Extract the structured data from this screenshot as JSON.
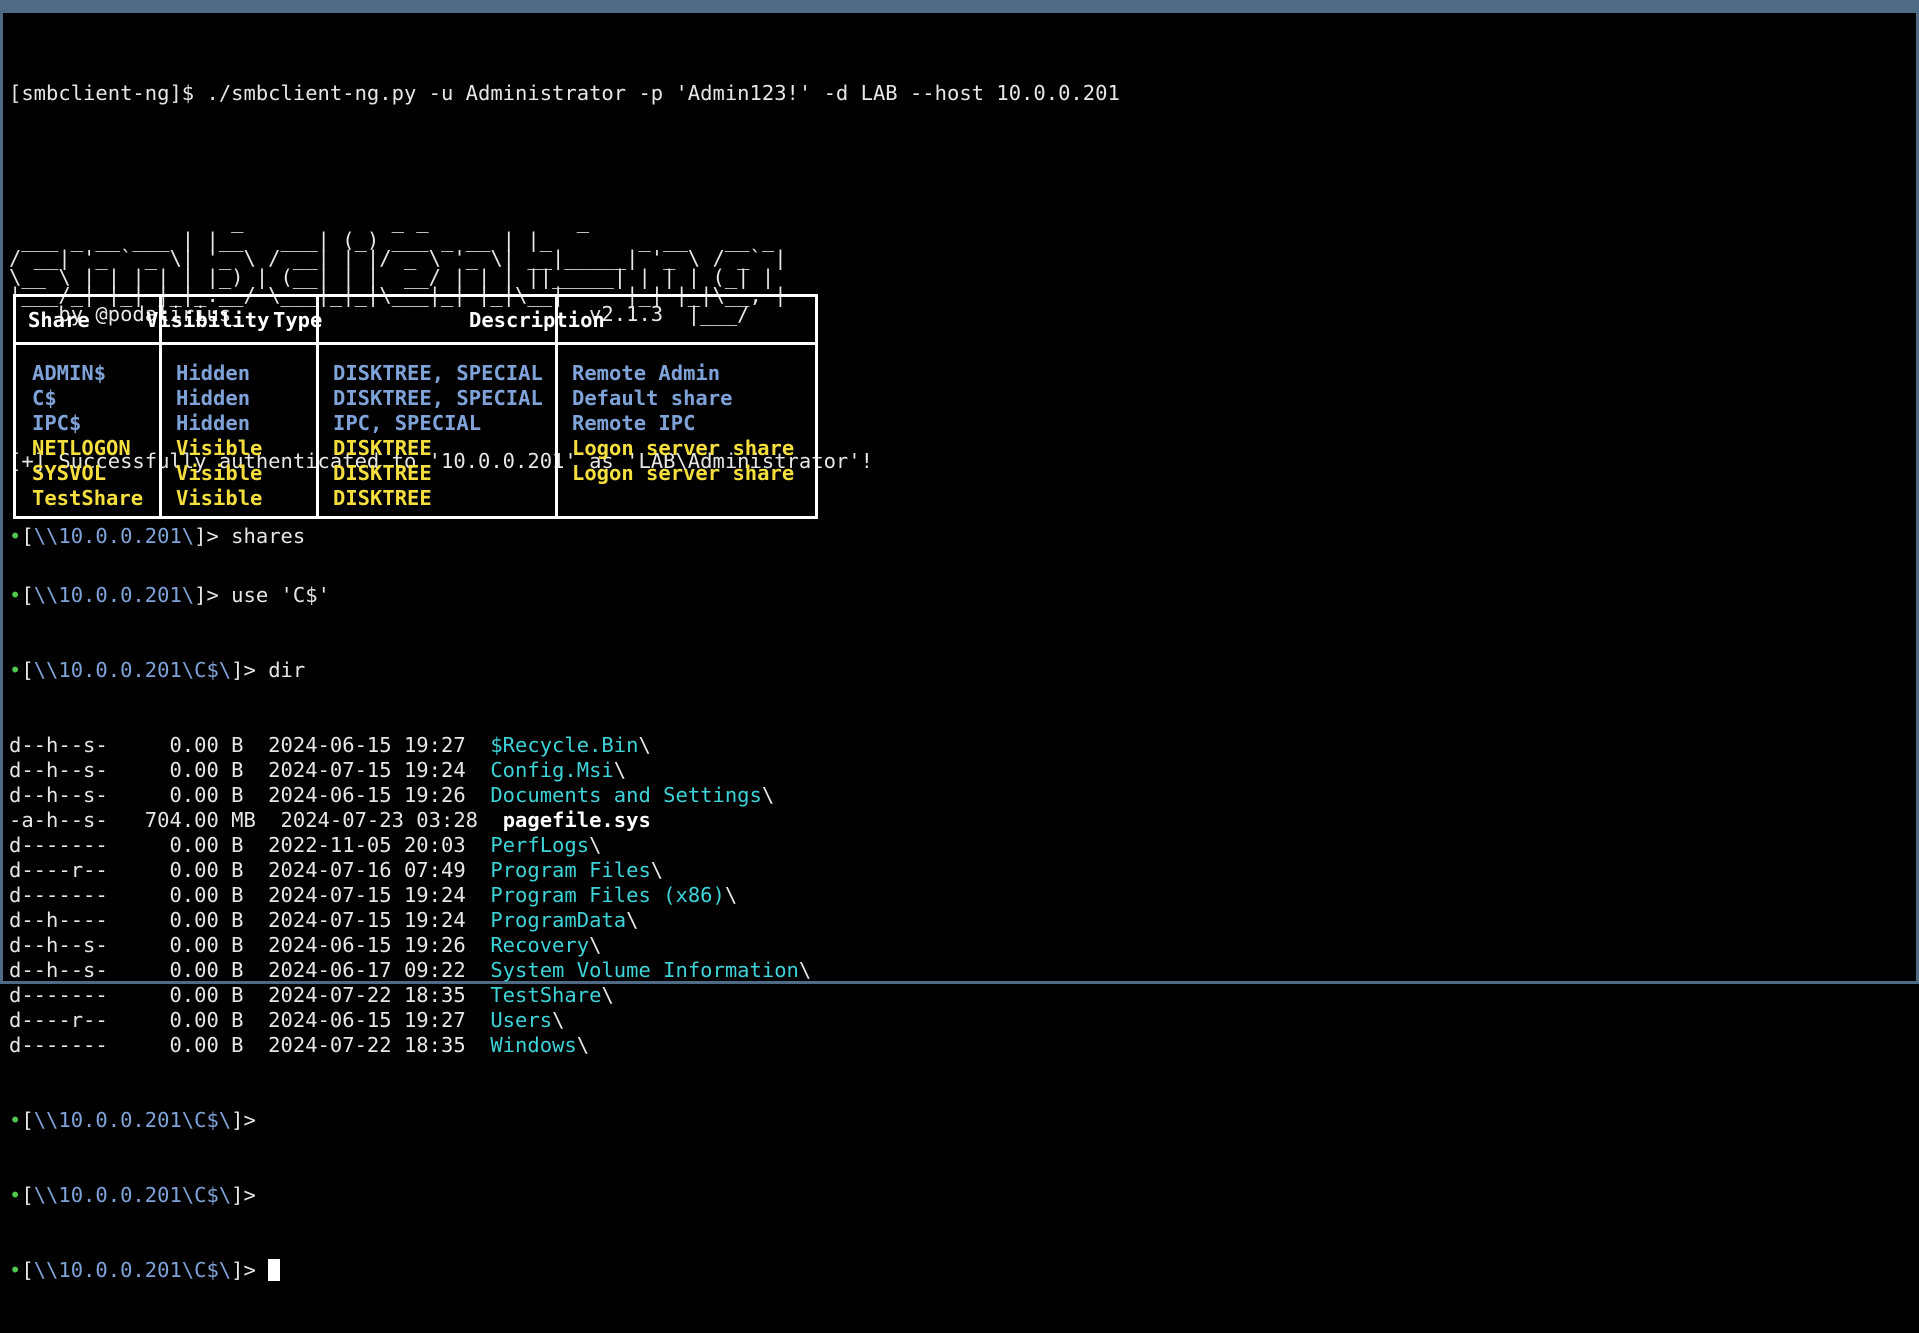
{
  "command": "[smbclient-ng]$ ./smbclient-ng.py -u Administrator -p 'Admin123!' -d LAB --host 10.0.0.201",
  "banner": [
    "                  _            _ _            _",
    " ___ _ __ ___ | |__   ___| (_) ___ _ __ | |_       _ __   __ _",
    "/ __| '_ ` _ \\| '_ \\ / __| | |/ _ \\ '_ \\| __|_____| '_ \\ / _` |",
    "\\__ \\ | | | | | |_) | (__| | |  __/ | | | ||_____| | | | (_| |",
    "|___/_| |_| |_|_.__/ \\___|_|_|\\___|_| |_|\\__|     |_| |_|\\__, |",
    "    by @podalirius_                            v2.1.3  |___/"
  ],
  "auth_message": "[+] Successfully authenticated to '10.0.0.201' as 'LAB\\Administrator'!",
  "prompts": {
    "bullet": "•",
    "root_path": "\\\\10.0.0.201\\",
    "c_path": "\\\\10.0.0.201\\C$\\",
    "shares_cmd": "shares",
    "use_cmd": "use 'C$'",
    "dir_cmd": "dir"
  },
  "shares_table": {
    "headers": [
      "Share",
      "Visibility",
      "Type",
      "Description"
    ],
    "rows": [
      {
        "share": "ADMIN$",
        "visibility": "Hidden",
        "type": "DISKTREE, SPECIAL",
        "description": "Remote Admin"
      },
      {
        "share": "C$",
        "visibility": "Hidden",
        "type": "DISKTREE, SPECIAL",
        "description": "Default share"
      },
      {
        "share": "IPC$",
        "visibility": "Hidden",
        "type": "IPC, SPECIAL",
        "description": "Remote IPC"
      },
      {
        "share": "NETLOGON",
        "visibility": "Visible",
        "type": "DISKTREE",
        "description": "Logon server share"
      },
      {
        "share": "SYSVOL",
        "visibility": "Visible",
        "type": "DISKTREE",
        "description": "Logon server share"
      },
      {
        "share": "TestShare",
        "visibility": "Visible",
        "type": "DISKTREE",
        "description": ""
      }
    ]
  },
  "listing": [
    {
      "attrs": "d--h--s-",
      "size": "   0.00 B",
      "date": "2024-06-15 19:27",
      "name": "$Recycle.Bin",
      "suffix": "\\"
    },
    {
      "attrs": "d--h--s-",
      "size": "   0.00 B",
      "date": "2024-07-15 19:24",
      "name": "Config.Msi",
      "suffix": "\\"
    },
    {
      "attrs": "d--h--s-",
      "size": "   0.00 B",
      "date": "2024-06-15 19:26",
      "name": "Documents and Settings",
      "suffix": "\\"
    },
    {
      "attrs": "-a-h--s-",
      "size": " 704.00 MB",
      "date": "2024-07-23 03:28",
      "name": "pagefile.sys",
      "suffix": ""
    },
    {
      "attrs": "d-------",
      "size": "   0.00 B",
      "date": "2022-11-05 20:03",
      "name": "PerfLogs",
      "suffix": "\\"
    },
    {
      "attrs": "d----r--",
      "size": "   0.00 B",
      "date": "2024-07-16 07:49",
      "name": "Program Files",
      "suffix": "\\"
    },
    {
      "attrs": "d-------",
      "size": "   0.00 B",
      "date": "2024-07-15 19:24",
      "name": "Program Files (x86)",
      "suffix": "\\"
    },
    {
      "attrs": "d--h----",
      "size": "   0.00 B",
      "date": "2024-07-15 19:24",
      "name": "ProgramData",
      "suffix": "\\"
    },
    {
      "attrs": "d--h--s-",
      "size": "   0.00 B",
      "date": "2024-06-15 19:26",
      "name": "Recovery",
      "suffix": "\\"
    },
    {
      "attrs": "d--h--s-",
      "size": "   0.00 B",
      "date": "2024-06-17 09:22",
      "name": "System Volume Information",
      "suffix": "\\"
    },
    {
      "attrs": "d-------",
      "size": "   0.00 B",
      "date": "2024-07-22 18:35",
      "name": "TestShare",
      "suffix": "\\"
    },
    {
      "attrs": "d----r--",
      "size": "   0.00 B",
      "date": "2024-06-15 19:27",
      "name": "Users",
      "suffix": "\\"
    },
    {
      "attrs": "d-------",
      "size": "   0.00 B",
      "date": "2024-07-22 18:35",
      "name": "Windows",
      "suffix": "\\"
    }
  ],
  "colors": {
    "hidden_share": "#7fa3d8",
    "visible_share": "#f5df3e",
    "directory": "#3ed3d8",
    "prompt_bullet": "#4ec94e",
    "window_border": "#4f6a85"
  }
}
